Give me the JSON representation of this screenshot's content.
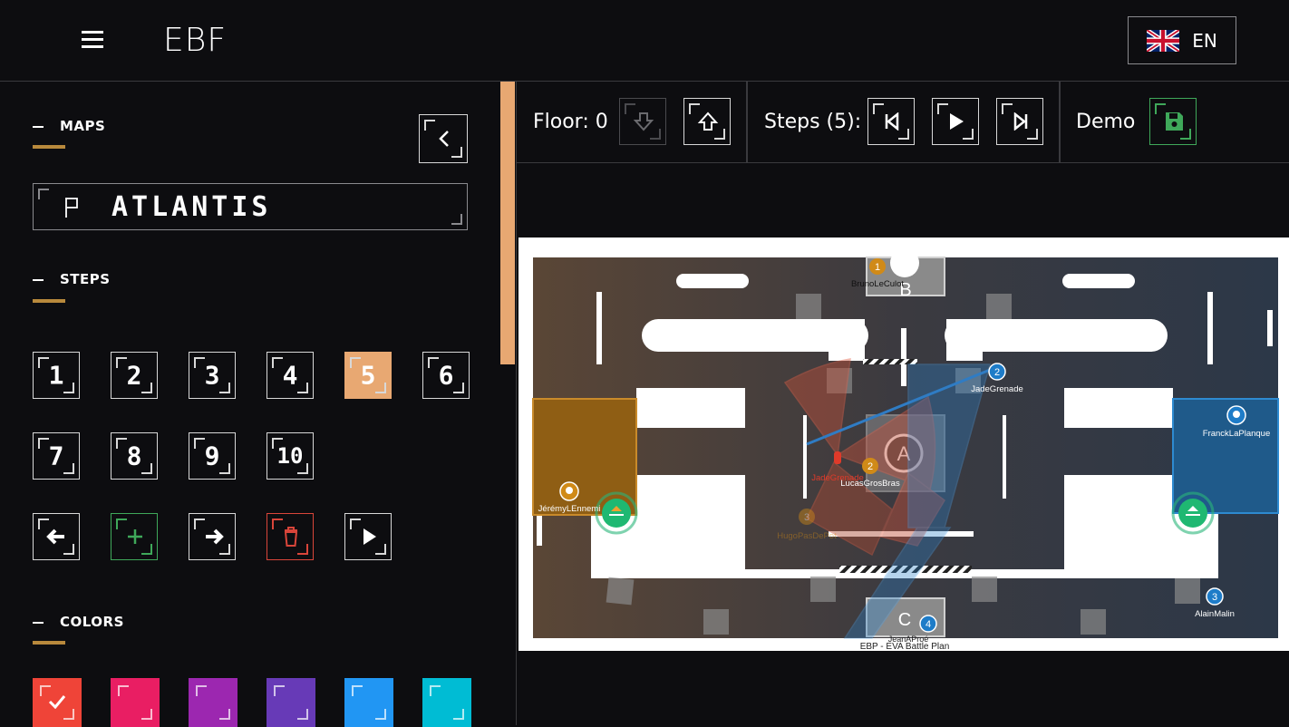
{
  "header": {
    "logo": "EBF",
    "language": "EN",
    "accent": "#b8893c"
  },
  "sidebar": {
    "maps_title": "MAPS",
    "map_name": "ATLANTIS",
    "steps_title": "STEPS",
    "steps": [
      "1",
      "2",
      "3",
      "4",
      "5",
      "6",
      "7",
      "8",
      "9",
      "10"
    ],
    "active_step": "5",
    "active_step_color": "#e8a872",
    "colors_title": "COLORS",
    "colors": [
      "#ef4438",
      "#e91e63",
      "#9c27b0",
      "#673ab7",
      "#2196f3",
      "#00bcd4"
    ],
    "selected_color": "#ef4438"
  },
  "toolbar": {
    "floor_label": "Floor: 0",
    "steps_label": "Steps (5):",
    "demo_label": "Demo"
  },
  "map": {
    "zones": [
      "A",
      "B",
      "C"
    ],
    "players": [
      {
        "name": "BrunoLeCulot",
        "number": "1",
        "team": "orange"
      },
      {
        "name": "JadeGrenade",
        "number": "2",
        "team": "blue"
      },
      {
        "name": "FranckLaPlanque",
        "number": "",
        "team": "blue"
      },
      {
        "name": "AlainMalin",
        "number": "3",
        "team": "blue"
      },
      {
        "name": "JadeGrenade",
        "number": "",
        "team": "red"
      },
      {
        "name": "LucasGrosBras",
        "number": "2",
        "team": "orange"
      },
      {
        "name": "HugoPasDePot",
        "number": "3",
        "team": "orange"
      },
      {
        "name": "JérémyLEnnemi",
        "number": "",
        "team": "orange"
      },
      {
        "name": "JeanAProé",
        "number": "4",
        "team": "blue"
      }
    ],
    "watermark": "EBP - EVA Battle Plan"
  }
}
